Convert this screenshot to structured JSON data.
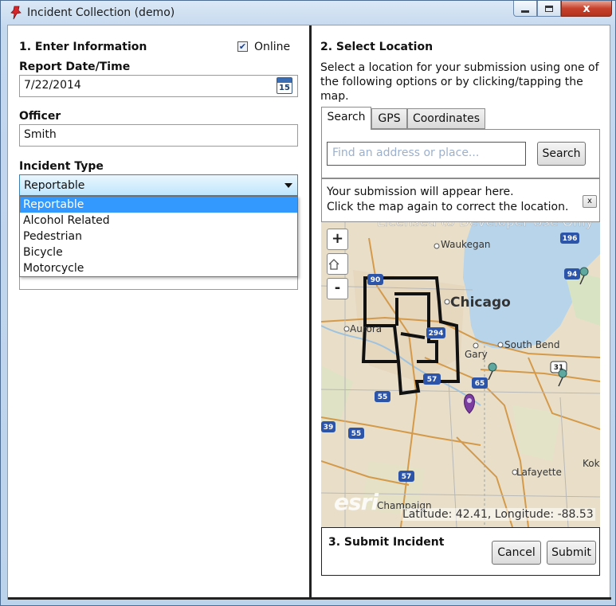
{
  "window": {
    "title": "Incident Collection (demo)",
    "close_glyph": "x"
  },
  "left": {
    "section_title": "1. Enter Information",
    "online_label": "Online",
    "online_checked": true,
    "report_date_label": "Report Date/Time",
    "report_date_value": "7/22/2014",
    "calendar_day": "15",
    "officer_label": "Officer",
    "officer_value": "Smith",
    "incident_type_label": "Incident Type",
    "incident_type_value": "Reportable",
    "incident_type_options": [
      "Reportable",
      "Alcohol Related",
      "Pedestrian",
      "Bicycle",
      "Motorcycle"
    ]
  },
  "right": {
    "section_title": "2. Select Location",
    "description": "Select a location for your submission using one of the following options or by clicking/tapping the map.",
    "tabs": [
      "Search",
      "GPS",
      "Coordinates"
    ],
    "active_tab": "Search",
    "search_placeholder": "Find an address or place...",
    "search_button": "Search",
    "notice_line1": "Your submission will appear here.",
    "notice_line2": "Click the map again to correct the location.",
    "notice_close": "x",
    "map": {
      "zoom_in": "+",
      "zoom_out": "-",
      "coordinates_text": "Latitude: 42.41, Longitude: -88.53",
      "attribution_logo": "esri",
      "watermark": "Licensed to Developer Use Only",
      "labels": [
        "Waukegan",
        "Chicago",
        "Aurora",
        "Gary",
        "South Bend",
        "Lafayette",
        "Champaign",
        "Kok"
      ],
      "highway_shields": [
        "90",
        "294",
        "57",
        "65",
        "55",
        "57",
        "39",
        "55",
        "196",
        "94",
        "31"
      ]
    },
    "submit_title": "3. Submit Incident",
    "cancel_button": "Cancel",
    "submit_button": "Submit"
  },
  "colors": {
    "selection": "#3399ff",
    "title_bar": "#c4d8ee",
    "close_button": "#c7422d",
    "lake": "#b7d4ea",
    "map_land": "#e9dfc9"
  }
}
